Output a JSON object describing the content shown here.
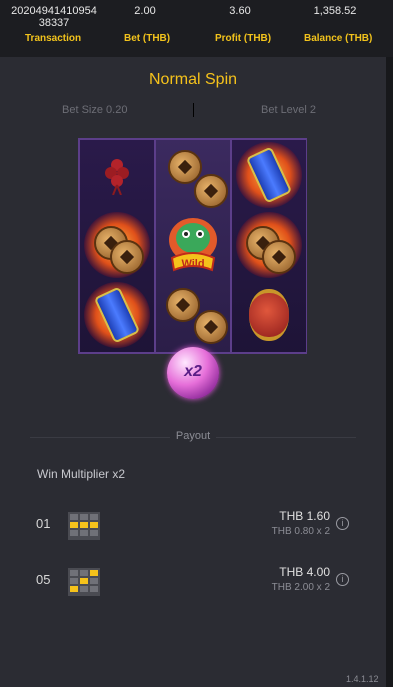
{
  "header": {
    "transaction_value_line1": "20204941410954",
    "transaction_value_line2": "38337",
    "transaction_label": "Transaction",
    "bet_value": "2.00",
    "bet_label": "Bet (THB)",
    "profit_value": "3.60",
    "profit_label": "Profit (THB)",
    "balance_value": "1,358.52",
    "balance_label": "Balance (THB)"
  },
  "spin": {
    "title": "Normal Spin",
    "bet_size": "Bet Size 0.20",
    "bet_level": "Bet Level 2"
  },
  "reels": [
    [
      "knot-icon",
      "coin-icon",
      "firecracker-can-icon"
    ],
    [
      "coin-icon",
      "wild-dragon-icon",
      "coin-icon"
    ],
    [
      "firecracker-can-icon",
      "coin-icon",
      "lantern-icon"
    ]
  ],
  "multiplier_bubble": "x2",
  "payout": {
    "heading": "Payout",
    "win_multiplier": "Win Multiplier x2",
    "rows": [
      {
        "id": "01",
        "amount": "THB 1.60",
        "detail": "THB 0.80 x 2",
        "pattern": [
          0,
          0,
          0,
          1,
          1,
          1,
          0,
          0,
          0
        ]
      },
      {
        "id": "05",
        "amount": "THB 4.00",
        "detail": "THB 2.00 x 2",
        "pattern": [
          0,
          0,
          1,
          0,
          1,
          0,
          1,
          0,
          0
        ]
      }
    ]
  },
  "version": "1.4.1.12",
  "colors": {
    "accent": "#f5c21b",
    "background": "#2b2c33",
    "header": "#1c1d21"
  }
}
